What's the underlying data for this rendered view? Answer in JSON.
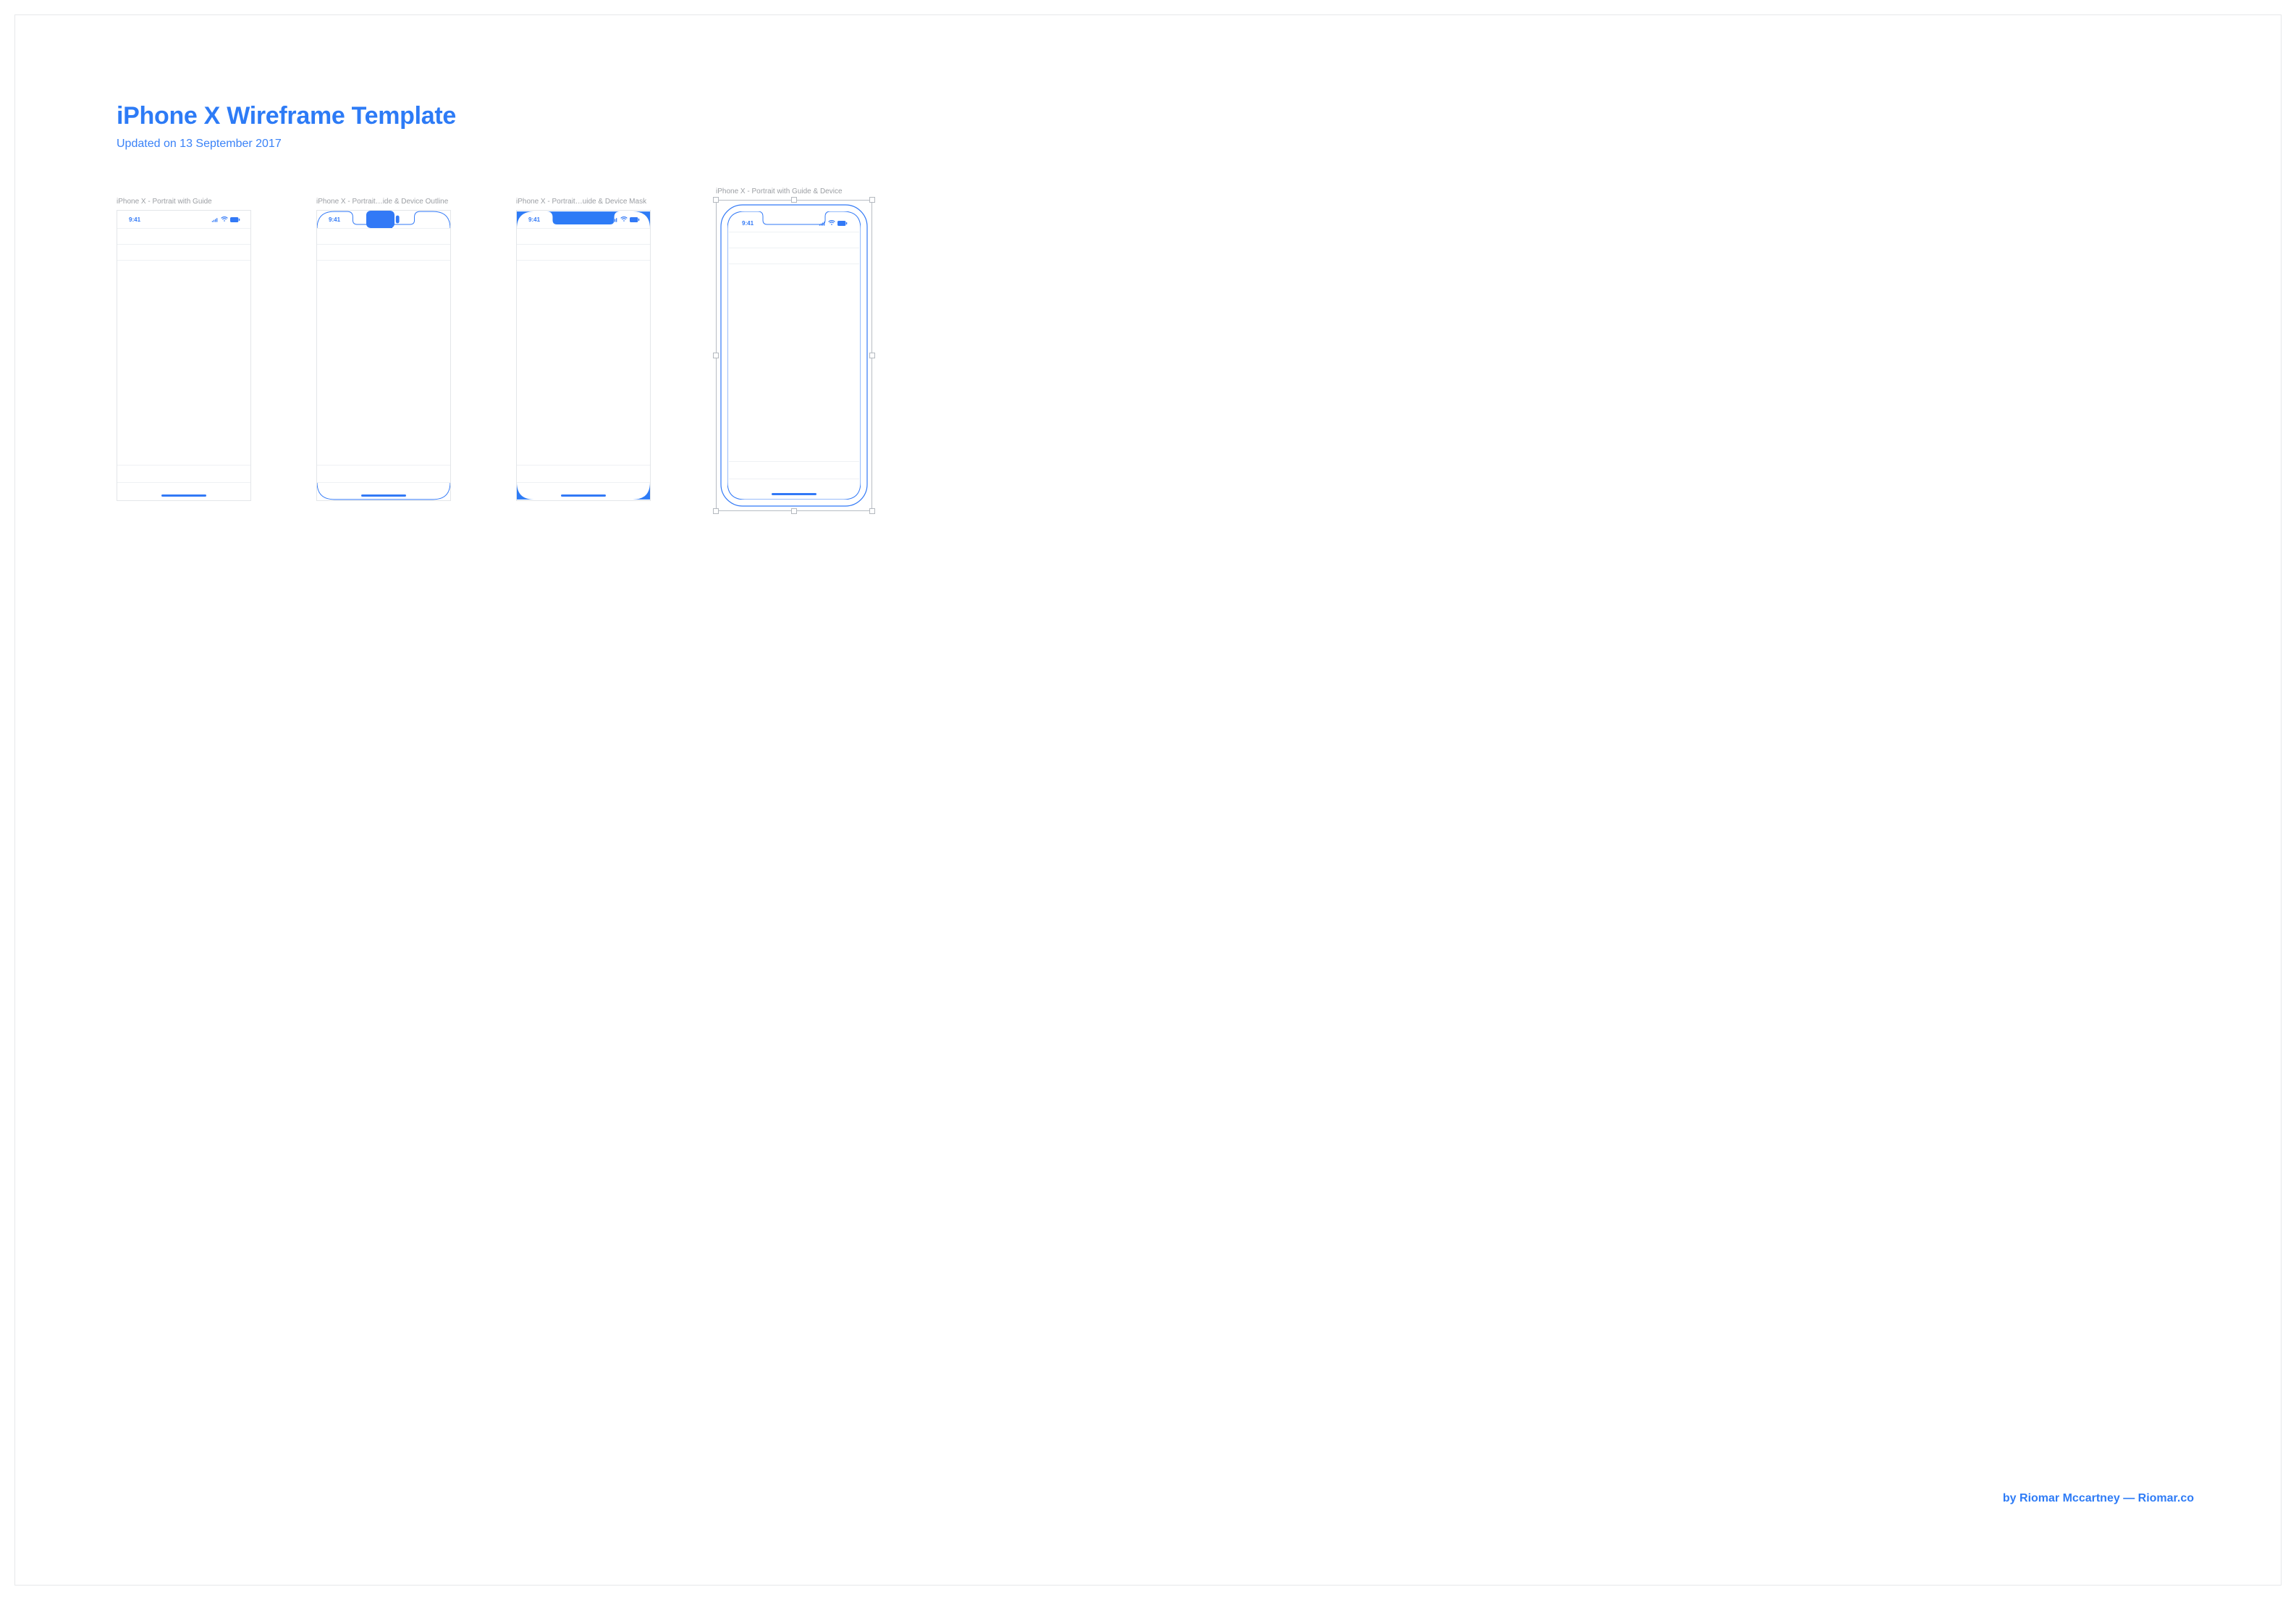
{
  "title": "iPhone X Wireframe Template",
  "subtitle": "Updated on 13 September 2017",
  "status_time": "9:41",
  "artboards": [
    {
      "label": "iPhone X - Portrait with Guide"
    },
    {
      "label": "iPhone X - Portrait…ide & Device Outline"
    },
    {
      "label": "iPhone X - Portrait…uide & Device Mask"
    },
    {
      "label": "iPhone X - Portrait with Guide & Device"
    }
  ],
  "credit": "by Riomar Mccartney — Riomar.co",
  "colors": {
    "brand": "#2d7bf6",
    "guide": "#eef1f4",
    "label": "#9b9ea3"
  }
}
